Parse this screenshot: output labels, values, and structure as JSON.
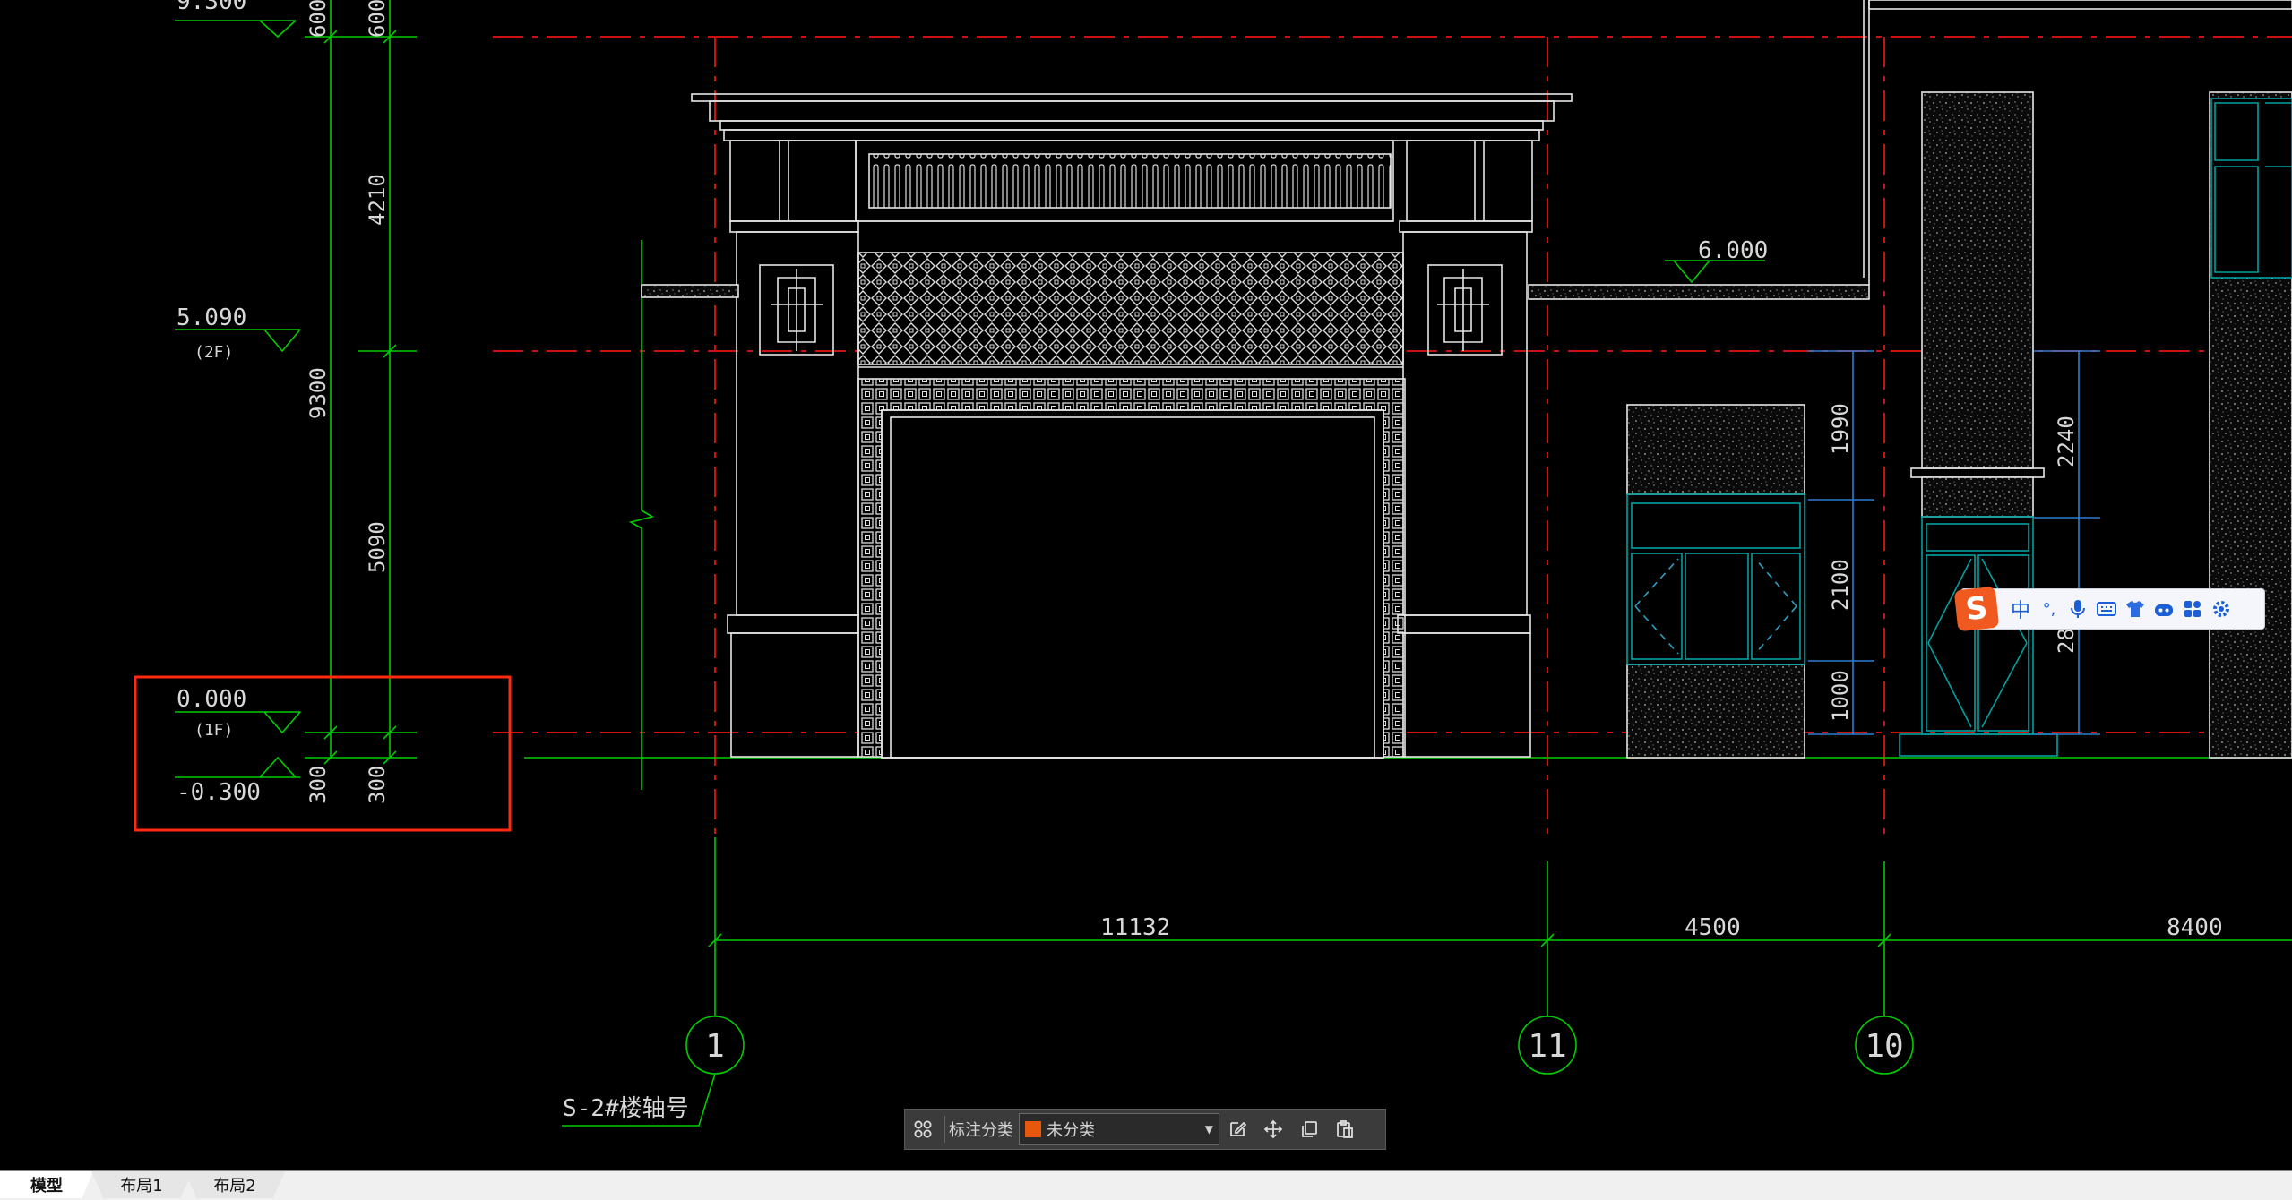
{
  "drawing": {
    "levels": [
      {
        "value": "9.300",
        "floor": ""
      },
      {
        "value": "5.090",
        "floor": "(2F)"
      },
      {
        "value": "0.000",
        "floor": "(1F)"
      },
      {
        "value": "-0.300",
        "floor": ""
      }
    ],
    "left_dims": {
      "outer": [
        "600",
        "9300",
        "300"
      ],
      "inner": [
        "600",
        "4210",
        "5090",
        "300"
      ]
    },
    "elevation_label": "6.000",
    "right_dims": {
      "col1": [
        "1990",
        "2100",
        "1000"
      ],
      "col2": [
        "2240",
        "28"
      ]
    },
    "axis_dims": [
      "11132",
      "4500",
      "8400"
    ],
    "axes": [
      "1",
      "11",
      "10"
    ],
    "axis_note": "S-2#楼轴号",
    "colors": {
      "background": "#000000",
      "dim_green": "#00cc00",
      "axis_red": "#cc0000",
      "facade_white": "#ffffff",
      "window_cyan": "#00a0a0",
      "dim_blue": "#2a7fd0",
      "highlight_box": "#ff2a10"
    }
  },
  "toolbar": {
    "grid_icon": "grid-icon",
    "label": "标注分类",
    "selected_category": "未分类",
    "category_color": "#e8580c",
    "icons": [
      "edit-icon",
      "move-icon",
      "copy-icon",
      "paste-icon"
    ]
  },
  "ime": {
    "logo": "S",
    "mode": "中",
    "punct": "°,",
    "icons": [
      "microphone-icon",
      "keyboard-icon",
      "skin-icon",
      "robot-icon",
      "toolbox-icon",
      "settings-icon"
    ]
  },
  "tabs": [
    {
      "label": "模型",
      "active": true
    },
    {
      "label": "布局1",
      "active": false
    },
    {
      "label": "布局2",
      "active": false
    }
  ]
}
